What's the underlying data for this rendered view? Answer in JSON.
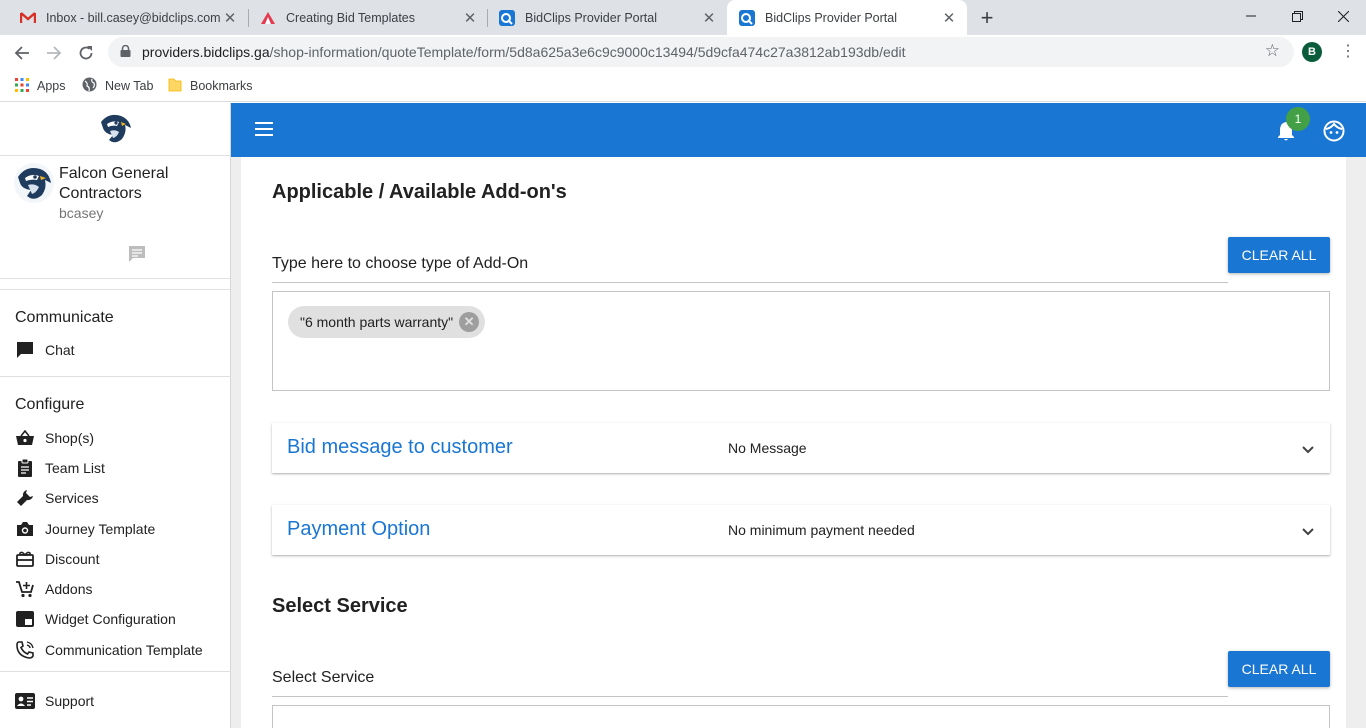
{
  "browser": {
    "tabs": [
      {
        "title": "Inbox - bill.casey@bidclips.com -",
        "icon": "gmail-icon"
      },
      {
        "title": "Creating Bid Templates",
        "icon": "bidclips-icon"
      },
      {
        "title": "BidClips Provider Portal",
        "icon": "portal-icon"
      },
      {
        "title": "BidClips Provider Portal",
        "icon": "portal-icon"
      }
    ],
    "url_host": "providers.bidclips.ga",
    "url_path": "/shop-information/quoteTemplate/form/5d8a625a3e6c9c9000c13494/5d9cfa474c27a3812ab193db/edit",
    "profile_initial": "B",
    "bookmarks": [
      {
        "label": "Apps",
        "icon": "apps-grid-icon"
      },
      {
        "label": "New Tab",
        "icon": "globe-icon"
      },
      {
        "label": "Bookmarks",
        "icon": "folder-icon"
      }
    ]
  },
  "sidebar": {
    "company_name": "Falcon General Contractors",
    "username": "bcasey",
    "communicate_heading": "Communicate",
    "communicate_items": [
      {
        "label": "Chat",
        "icon": "chat-icon"
      }
    ],
    "configure_heading": "Configure",
    "configure_items": [
      {
        "label": "Shop(s)",
        "icon": "basket-icon"
      },
      {
        "label": "Team List",
        "icon": "clipboard-icon"
      },
      {
        "label": "Services",
        "icon": "wrench-icon"
      },
      {
        "label": "Journey Template",
        "icon": "camera-icon"
      },
      {
        "label": "Discount",
        "icon": "gift-card-icon"
      },
      {
        "label": "Addons",
        "icon": "cart-plus-icon"
      },
      {
        "label": "Widget Configuration",
        "icon": "widget-icon"
      },
      {
        "label": "Communication Template",
        "icon": "phone-icon"
      }
    ],
    "support": {
      "label": "Support",
      "icon": "contact-card-icon"
    }
  },
  "appbar": {
    "notification_count": "1",
    "colors": {
      "primary": "#1976d2",
      "badge": "#43a047"
    }
  },
  "main": {
    "addons_title": "Applicable / Available Add-on's",
    "addon_input_placeholder": "Type here to choose type of Add-On",
    "clear_all_label": "CLEAR ALL",
    "selected_addons": [
      "\"6 month parts warranty\""
    ],
    "bid_message": {
      "title": "Bid message to customer",
      "value": "No Message"
    },
    "payment_option": {
      "title": "Payment Option",
      "value": "No minimum payment needed"
    },
    "select_service_title": "Select Service",
    "select_service_placeholder": "Select Service",
    "clear_all_label_2": "CLEAR ALL"
  }
}
